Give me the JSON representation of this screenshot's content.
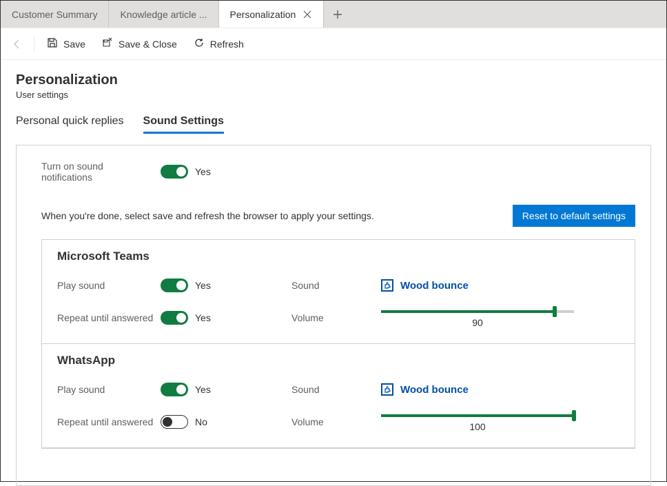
{
  "tabs": [
    {
      "label": "Customer Summary",
      "active": false
    },
    {
      "label": "Knowledge article ...",
      "active": false
    },
    {
      "label": "Personalization",
      "active": true
    }
  ],
  "toolbar": {
    "save": "Save",
    "saveClose": "Save & Close",
    "refresh": "Refresh"
  },
  "page": {
    "title": "Personalization",
    "subtitle": "User settings"
  },
  "subTabs": [
    {
      "label": "Personal quick replies",
      "active": false
    },
    {
      "label": "Sound Settings",
      "active": true
    }
  ],
  "soundNotifications": {
    "label": "Turn on sound notifications",
    "on": true,
    "value": "Yes"
  },
  "hint": "When you're done, select save and refresh the browser to apply your settings.",
  "resetLabel": "Reset to default settings",
  "channels": [
    {
      "name": "Microsoft Teams",
      "playSoundLabel": "Play sound",
      "playSound": true,
      "playSoundValue": "Yes",
      "soundLabel": "Sound",
      "soundName": "Wood bounce",
      "repeatLabel": "Repeat until answered",
      "repeat": true,
      "repeatValue": "Yes",
      "volumeLabel": "Volume",
      "volume": 90
    },
    {
      "name": "WhatsApp",
      "playSoundLabel": "Play sound",
      "playSound": true,
      "playSoundValue": "Yes",
      "soundLabel": "Sound",
      "soundName": "Wood bounce",
      "repeatLabel": "Repeat until answered",
      "repeat": false,
      "repeatValue": "No",
      "volumeLabel": "Volume",
      "volume": 100
    }
  ]
}
